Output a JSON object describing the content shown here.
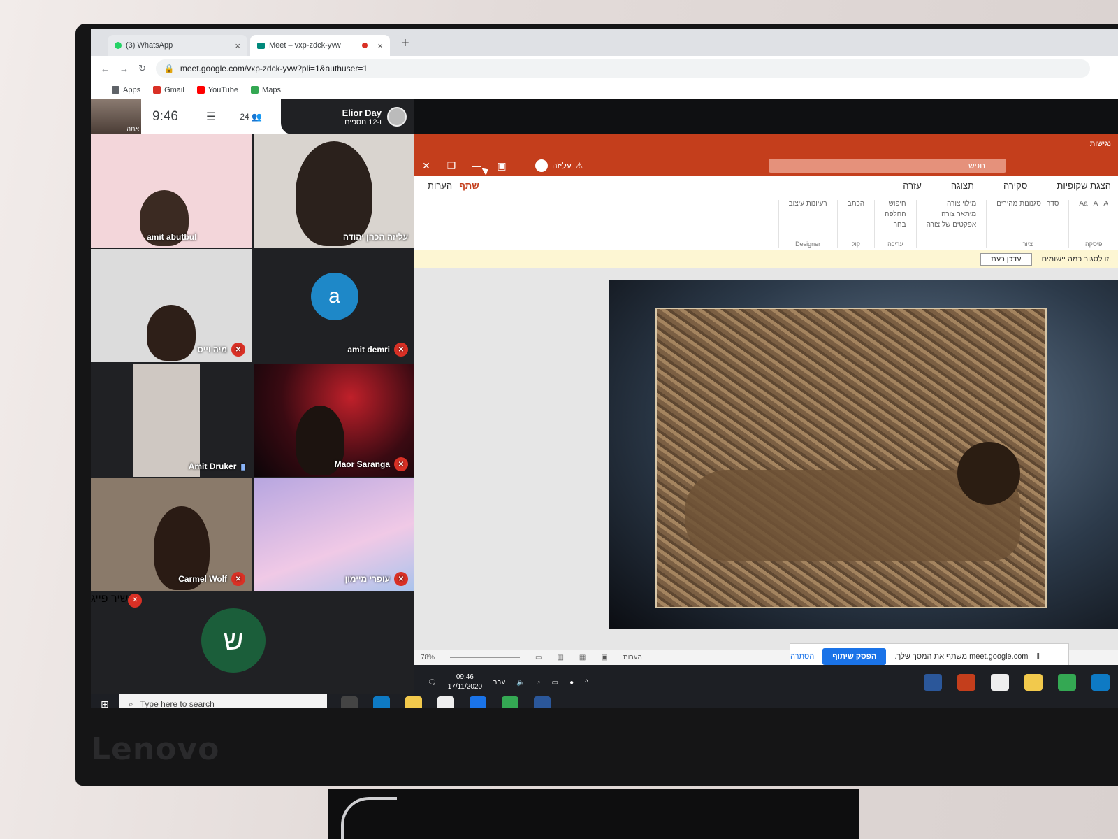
{
  "browser": {
    "tabs": [
      {
        "label": "(3) WhatsApp",
        "active": false
      },
      {
        "label": "Meet – vxp-zdck-yvw",
        "active": true
      }
    ],
    "new_tab": "+",
    "url": "meet.google.com/vxp-zdck-yvw?pli=1&authuser=1",
    "bookmarks": [
      {
        "label": "Apps",
        "color": "#5f6368"
      },
      {
        "label": "Gmail",
        "color": "#d93025"
      },
      {
        "label": "YouTube",
        "color": "#ff0000"
      },
      {
        "label": "Maps",
        "color": "#34a853"
      }
    ]
  },
  "meet": {
    "self_label": "אתה",
    "time": "9:46",
    "participants_count": "24",
    "presenter": {
      "name": "Elior Day",
      "others": "ו-12 נוספים"
    },
    "tiles": [
      {
        "name": "amit abutbul",
        "muted": false,
        "bg": "#f3d6da"
      },
      {
        "name": "עליזה הכהן יהודה",
        "muted": false,
        "bg": "#d9d4cf"
      },
      {
        "name": "מיה וייס",
        "muted": true,
        "bg": "#dcdcdc"
      },
      {
        "name": "amit demri",
        "muted": true,
        "bg": "#202124",
        "avatar": "a",
        "avatar_color": "#1e88c8"
      },
      {
        "name": "Amit Druker",
        "muted": false,
        "bg": "#202124"
      },
      {
        "name": "Maor Saranga",
        "muted": true,
        "bg": "#2a0d12"
      },
      {
        "name": "Carmel Wolf",
        "muted": true,
        "bg": "#8a7a6a"
      },
      {
        "name": "עופרי מיימון",
        "muted": true,
        "bg": "#c9b7e6"
      }
    ],
    "big_tile": {
      "name": "שיר פייג",
      "avatar": "ש",
      "avatar_color": "#1b5e3a",
      "muted": true
    }
  },
  "left_taskbar": {
    "search_placeholder": "Type here to search"
  },
  "ppt": {
    "strip_text": "נגישות",
    "search": "חפש",
    "user": "עליזה",
    "tabs": [
      "הצגת שקופיות",
      "סקירה",
      "תצוגה",
      "עזרה"
    ],
    "share": "שתף",
    "comments": "הערות",
    "groups": [
      {
        "name": "פיסקה",
        "items": [
          "A",
          "A",
          "Aa"
        ]
      },
      {
        "name": "ציור",
        "items": [
          "סדר",
          "סגנונות מהירים"
        ]
      },
      {
        "name": "",
        "items": [
          "מילוי צורה",
          "מיתאר צורה",
          "אפקטים של צורה"
        ]
      },
      {
        "name": "עריכה",
        "items": [
          "חיפוש",
          "החלפה",
          "בחר"
        ]
      },
      {
        "name": "קול",
        "items": [
          "הכתב"
        ]
      },
      {
        "name": "Designer",
        "items": [
          "רעיונות עיצוב"
        ]
      }
    ],
    "info_text": "זו לסגור כמה יישומים.",
    "update_button": "עדכן כעת",
    "zoom": "78%",
    "notes": "הערות",
    "sharing_text": "meet.google.com משתף את המסך שלך.",
    "stop_sharing": "הפסק שיתוף",
    "hide": "הסתרה"
  },
  "right_taskbar": {
    "time": "09:46",
    "date": "17/11/2020",
    "lang": "עבר"
  },
  "brand": "Lenovo"
}
